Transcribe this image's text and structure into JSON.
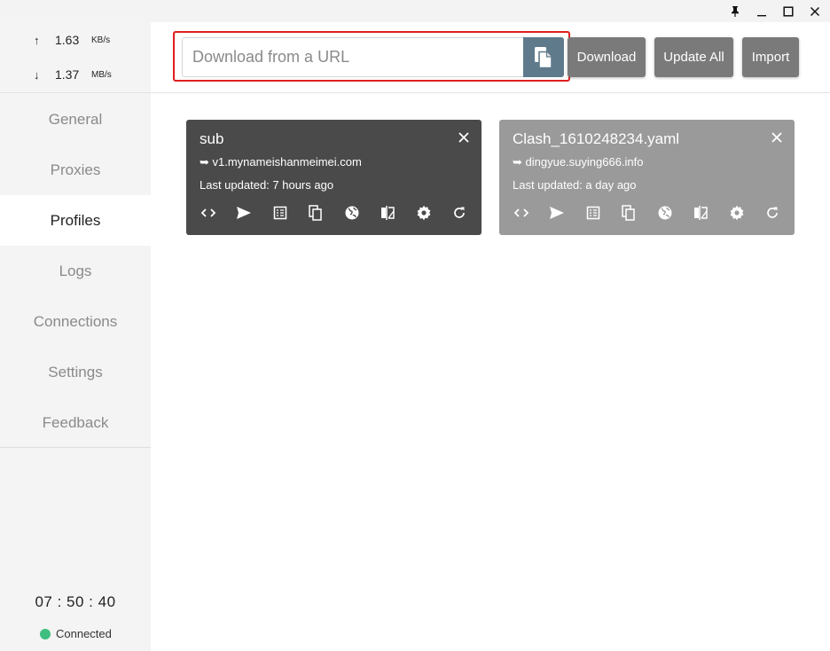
{
  "window": {
    "controls": [
      "pin-icon",
      "minimize-icon",
      "maximize-icon",
      "close-icon"
    ]
  },
  "traffic": {
    "up_arrow": "↑",
    "up_value": "1.63",
    "up_unit": "KB/s",
    "down_arrow": "↓",
    "down_value": "1.37",
    "down_unit": "MB/s"
  },
  "nav": {
    "items": [
      {
        "label": "General"
      },
      {
        "label": "Proxies"
      },
      {
        "label": "Profiles"
      },
      {
        "label": "Logs"
      },
      {
        "label": "Connections"
      },
      {
        "label": "Settings"
      },
      {
        "label": "Feedback"
      }
    ],
    "active": "Profiles"
  },
  "footer": {
    "clock": "07 : 50 : 40",
    "status": "Connected",
    "status_color": "#3fbf7f"
  },
  "header": {
    "url_placeholder": "Download from a URL",
    "url_value": "",
    "paste_icon": "copy-icon",
    "download_label": "Download",
    "update_all_label": "Update All",
    "import_label": "Import",
    "highlight_color": "#e01e1e"
  },
  "profiles": [
    {
      "title": "sub",
      "url": "➥ v1.mynameishanmeimei.com",
      "updated": "Last updated: 7 hours ago",
      "background": "#4a4a4a",
      "selected": true
    },
    {
      "title": "Clash_1610248234.yaml",
      "url": "➥ dingyue.suying666.info",
      "updated": "Last updated: a day ago",
      "background": "#9a9a9a",
      "selected": false
    }
  ],
  "card_actions": [
    "code-icon",
    "send-icon",
    "list-icon",
    "copy-icon",
    "globe-icon",
    "compare-icon",
    "gear-icon",
    "refresh-icon"
  ],
  "colors": {
    "sidebar_bg": "#f4f4f4",
    "button_bg": "#7a7a7a",
    "paste_bg": "#5f7a8b"
  }
}
